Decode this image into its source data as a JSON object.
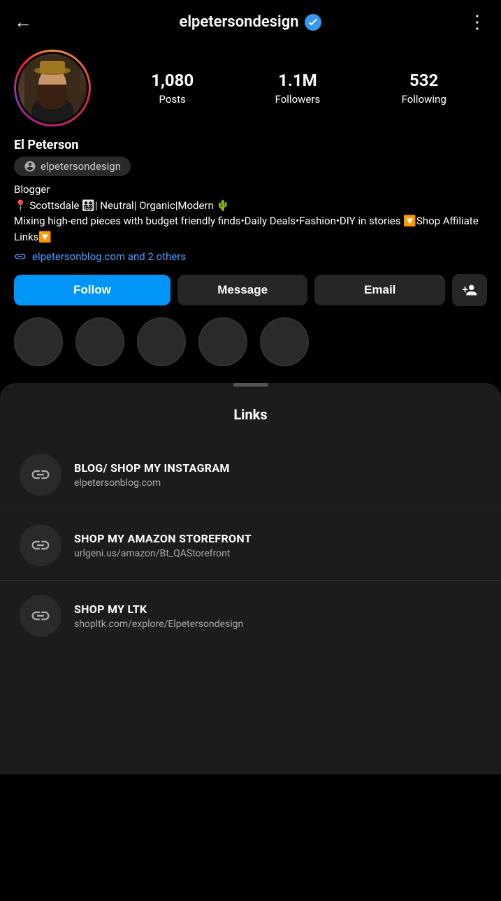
{
  "header": {
    "username": "elpetersondesign",
    "back_label": "←",
    "menu_label": "⋮"
  },
  "profile": {
    "display_name": "El Peterson",
    "threads_handle": "elpetersondesign",
    "bio_category": "Blogger",
    "bio_text": "📍 Scottsdale 👨‍👩‍👧‍👦| Neutral| Organic|Modern 🌵\nMixing high-end pieces with budget friendly finds•Daily Deals•Fashion•DIY in stories 🔽Shop Affiliate Links🔽",
    "link_text": "elpetersonblog.com and 2 others",
    "stats": {
      "posts_count": "1,080",
      "posts_label": "Posts",
      "followers_count": "1.1M",
      "followers_label": "Followers",
      "following_count": "532",
      "following_label": "Following"
    }
  },
  "actions": {
    "follow_label": "Follow",
    "message_label": "Message",
    "email_label": "Email",
    "add_friend_icon": "person-add"
  },
  "sheet": {
    "title": "Links",
    "links": [
      {
        "title": "BLOG/ SHOP MY INSTAGRAM",
        "url": "elpetersonblog.com"
      },
      {
        "title": "SHOP MY AMAZON STOREFRONT",
        "url": "urlgeni.us/amazon/Bt_QAStorefront"
      },
      {
        "title": "SHOP MY LTK",
        "url": "shopltk.com/explore/Elpetersondesign"
      }
    ]
  }
}
